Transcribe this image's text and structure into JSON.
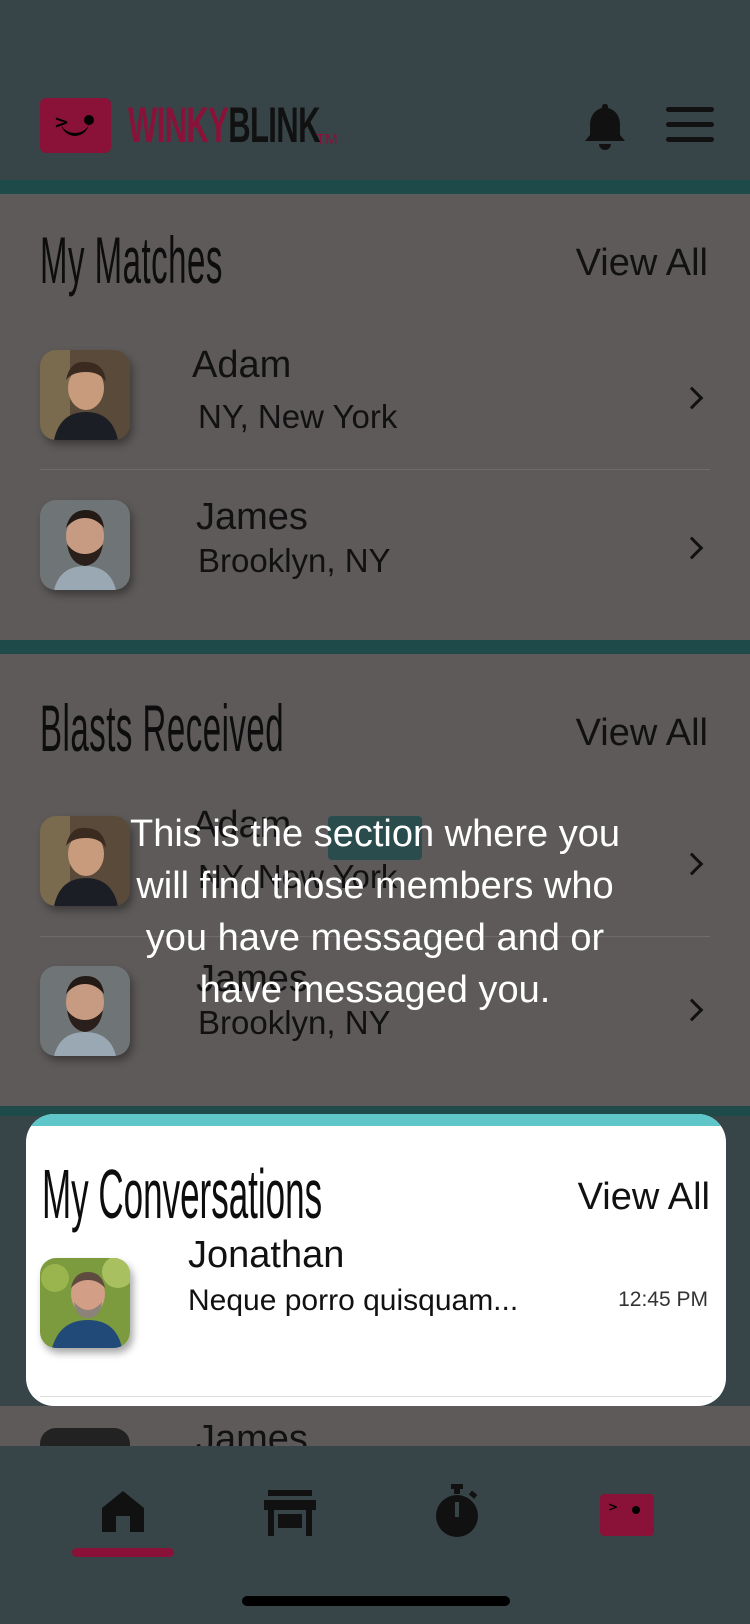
{
  "header": {
    "brand_part1": "WINKY",
    "brand_part2": "BLINK",
    "brand_tm": "TM"
  },
  "matches": {
    "title": "My Matches",
    "view_all": "View All",
    "items": [
      {
        "name": "Adam",
        "location": "NY, New York"
      },
      {
        "name": "James",
        "location": "Brooklyn, NY"
      }
    ]
  },
  "blasts": {
    "title": "Blasts Received",
    "view_all": "View All",
    "items": [
      {
        "name": "Adam",
        "location": "NY, New York"
      },
      {
        "name": "James",
        "location": "Brooklyn, NY"
      }
    ]
  },
  "conversations": {
    "title": "My Conversations",
    "view_all": "View All",
    "items": [
      {
        "name": "Jonathan",
        "preview": "Neque porro quisquam...",
        "time": "12:45 PM"
      },
      {
        "name": "James"
      }
    ]
  },
  "tooltip": {
    "text": "This is the section where you will find those members who you have messaged and or have messaged you."
  },
  "colors": {
    "brand": "#8a1138",
    "background": "#374549",
    "highlight": "#5fc7c9"
  },
  "nav": {
    "items": [
      "home-icon",
      "store-icon",
      "stopwatch-icon",
      "winkyblink-icon"
    ],
    "active": "home-icon"
  }
}
